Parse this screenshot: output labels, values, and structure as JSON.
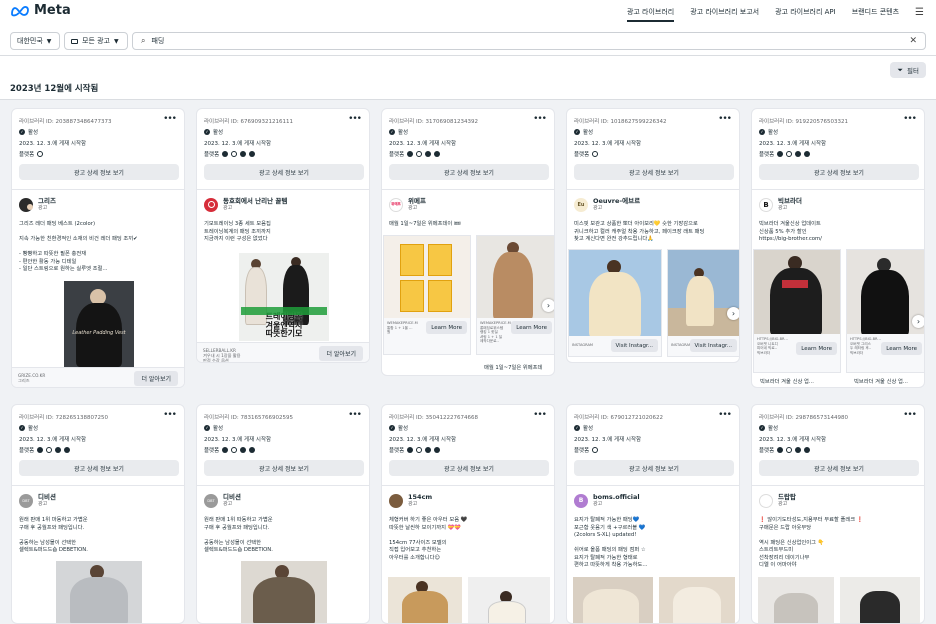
{
  "header": {
    "logo_text": "Meta",
    "nav": [
      "광고 라이브러리",
      "광고 라이브러리 보고서",
      "광고 라이브러리 API",
      "브랜디드 콘텐츠"
    ],
    "menu_glyph": "☰"
  },
  "filters": {
    "country": "대한민국",
    "ad_category": "모든 광고",
    "search_value": "패딩",
    "search_glyph": "⌕",
    "clear_glyph": "✕"
  },
  "results": {
    "heading": "2023년 12월에 시작됨",
    "filter_label": "필터"
  },
  "common": {
    "status": "활성",
    "started": "2023. 12. 3.에 게재 시작함",
    "platforms_label": "플랫폼",
    "detail_button": "광고 상세 정보 보기",
    "sponsored": "광고",
    "more_dots": "•••"
  },
  "row1": [
    {
      "library_id": "라이브러리 ID: 2038873486477373",
      "advertiser": "그리즈",
      "avatar_text": "",
      "avatar_color": "#2b2b2b",
      "body": "그리즈 레더 패딩 베스트 (2color)\n\n지속 가능한 친환경적인 소재의 비건 레더 패딩 조끼✔\n\n- 빵빵하고 따뜻한 필폰 충전재\n- 편안한 활동 가능 디테일\n- 일단 스트링으로 원하는 실루엣 조절...",
      "image_text": "Leather Padding Vest",
      "domain": "GRIZE.CO.KR\n그리즈",
      "cta": "더 알아보기"
    },
    {
      "library_id": "라이브러리 ID: 676909321216111",
      "advertiser": "동호회에서 난리난 꿀템",
      "avatar_text": "",
      "avatar_color": "#d62d3a",
      "body": "기모트레이닝 3종 세트 모음집\n트레이닝복계의 패딩 조끼까지\n지금까지 이런 구성은 없었다",
      "image_text": "트레이닝복\n겨울엔역시\n따뜻한기모",
      "domain": "SELLERBALL.KR\n겨우내 시 1장을 활용\n판정 수장 옵션",
      "cta": "더 알아보기"
    },
    {
      "library_id": "라이브러리 ID: 317069081234392",
      "advertiser": "위메프",
      "avatar_text": "위메프",
      "avatar_color": "#ffffff",
      "body": "매월 1일~7일은 위메프데이 🎟",
      "slides": [
        {
          "domain": "WEMAKEPRICE.M\n통합 1 + 1을 ...\n원",
          "cta": "Learn More"
        },
        {
          "domain": "WEMAKEPRICE.M\n롱패딩로위스템\n랭킹 1 핫딜\n셔링 1 + 1 딜\n제작다운로..",
          "cta": "Learn More"
        }
      ],
      "caption": "매월 1일~7일은 위메프데"
    },
    {
      "library_id": "라이브러리 ID: 1018627599226342",
      "advertiser": "Oeuvre-에브르",
      "avatar_text": "Eu",
      "avatar_color": "#f6ecd2",
      "body": "미스핏 보관고 상품한 뽀더 아이보리💛 숏한 기장감으로\n귀니크하고 컬러 캐주얼 착용 가능하고, 페이크장 래트 패딩\n찾고 계신다면 완전 강추드립니다🙏",
      "slides": [
        {
          "domain": "INSTAGRAM",
          "cta": "Visit Instagr..."
        },
        {
          "domain": "INSTAGRAM",
          "cta": "Visit Instagr..."
        }
      ]
    },
    {
      "library_id": "라이브러리 ID: 919220576503321",
      "advertiser": "빅브라더",
      "avatar_text": "B",
      "avatar_color": "#ffffff",
      "body": "빅브라더 겨울신상 업데이트\n신상품 5% 추가 할인\nhttps://big-brother.com/",
      "slides": [
        {
          "domain": "HTTPS://BIG-BR...\n오버핏 니트디\n피어네 빅로..\n빅브라더",
          "cta": "Learn More"
        },
        {
          "domain": "HTTPS://BIG-BR...\n오버핏 그리스\n두 레터링 후..\n빅브라더",
          "cta": "Learn More"
        }
      ],
      "caption": "빅브라더 겨울 신상 업..."
    }
  ],
  "row2": [
    {
      "library_id": "라이브러리 ID: 728265138807250",
      "advertiser": "디비션",
      "avatar_text": "DBT",
      "avatar_color": "#9a9a9a",
      "body": "원래 판매 1위 마동하고 가볍운\n구매 후 공월프와 패딩입니다.\n\n공동하는 남성몰이 선택한\n셀렉트&퍼드드숍 DEBETION."
    },
    {
      "library_id": "라이브러리 ID: 783165766902595",
      "advertiser": "디비션",
      "avatar_text": "DBT",
      "avatar_color": "#9a9a9a",
      "body": "원래 판매 1위 따동하고 가볍운\n구매 후 공월프와 패딩입니다.\n\n공동하는 남성몰이 선택한\n셀렉트&퍼드드숍 DEBETION."
    },
    {
      "library_id": "라이브러리 ID: 350412227674668",
      "advertiser": "154cm",
      "avatar_text": "",
      "avatar_color": "#7b5c3e",
      "body": "체형커버 하기 좋은 아우터 모음 🖤\n따뜻한 날씬하 보이기까지 💝💝\n\n154cm 77사이즈 모델의\n직접 입어보고 추천하는\n아우터를 소개합니다☺"
    },
    {
      "library_id": "라이브러리 ID: 679012721020622",
      "advertiser": "boms.official",
      "avatar_text": "B",
      "avatar_color": "#b07cd1",
      "body": "요지가 탈폐적 가능한 패딩💙\n포근함 웃음기 색 +구르러블 💙\n(2colors S-XL) updated!\n\n쉬어로 올폼 패딩의 패딩 점퍼 ☆\n요지가 탈폐적 가능한 형태로\n편하고 따뜻하게 착용 가능하도..."
    },
    {
      "library_id": "라이브러리 ID: 298786573144980",
      "advertiser": "드랍탑",
      "avatar_text": "",
      "avatar_color": "#ffffff",
      "body": "❗ 않이기도타성도,지용부터 무료할 플레크 ❗\n구매문은 드랍 아웃부당\n\n역시 패딩은 신상업인이그 👇\n스트리트무드미\n선착장려리 데이기나무\n디엘 이 어마아야"
    }
  ]
}
